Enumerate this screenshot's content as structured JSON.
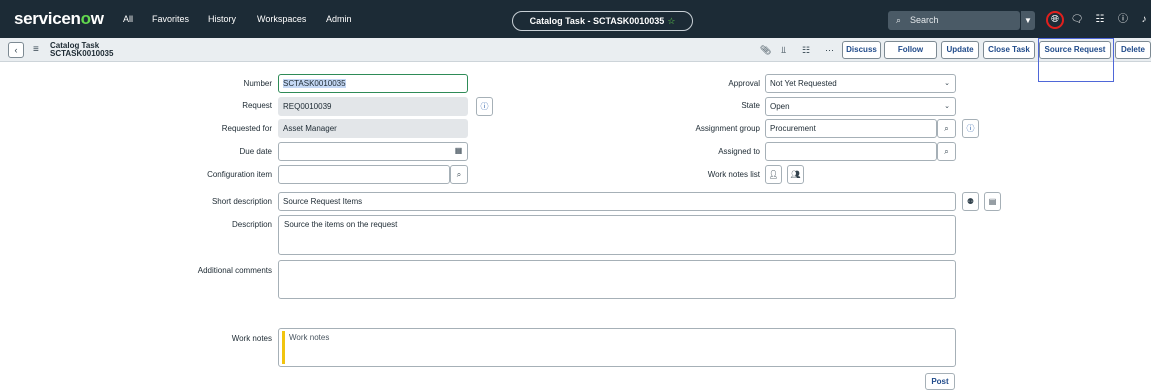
{
  "nav": {
    "logo": "servicen",
    "logo_o": "o",
    "logo_end": "w",
    "links": [
      "All",
      "Favorites",
      "History",
      "Workspaces",
      "Admin"
    ],
    "pill_title": "Catalog Task - SCTASK0010035",
    "pill_star": "☆",
    "search_placeholder": "Search",
    "icons": [
      "globe-icon",
      "chat-icon",
      "inbox-icon",
      "help-icon",
      "bell-icon"
    ]
  },
  "header": {
    "title": "Catalog Task",
    "number": "SCTASK0010035",
    "buttons": {
      "discuss": "Discuss",
      "follow": "Follow",
      "update": "Update",
      "close_task": "Close Task",
      "source_request": "Source Request",
      "delete": "Delete"
    }
  },
  "form": {
    "number": {
      "label": "Number",
      "value": "SCTASK0010035"
    },
    "request": {
      "label": "Request",
      "value": "REQ0010039"
    },
    "requested_for": {
      "label": "Requested for",
      "value": "Asset Manager"
    },
    "due_date": {
      "label": "Due date",
      "value": ""
    },
    "configuration_item": {
      "label": "Configuration item",
      "value": ""
    },
    "approval": {
      "label": "Approval",
      "value": "Not Yet Requested"
    },
    "state": {
      "label": "State",
      "value": "Open"
    },
    "assignment_group": {
      "label": "Assignment group",
      "value": "Procurement"
    },
    "assigned_to": {
      "label": "Assigned to",
      "value": ""
    },
    "work_notes_list": {
      "label": "Work notes list"
    },
    "short_description": {
      "label": "Short description",
      "value": "Source Request Items"
    },
    "description": {
      "label": "Description",
      "value": "Source the items on the request"
    },
    "additional_comments": {
      "label": "Additional comments",
      "value": ""
    },
    "work_notes": {
      "label": "Work notes",
      "placeholder": "Work notes"
    },
    "post_label": "Post"
  },
  "colors": {
    "nav_bg": "#1c2b36",
    "brand_green": "#62d84e",
    "highlight_box": "#4f67d8",
    "globe_ring": "#e0201d",
    "work_notes_bar": "#f1c40f"
  }
}
